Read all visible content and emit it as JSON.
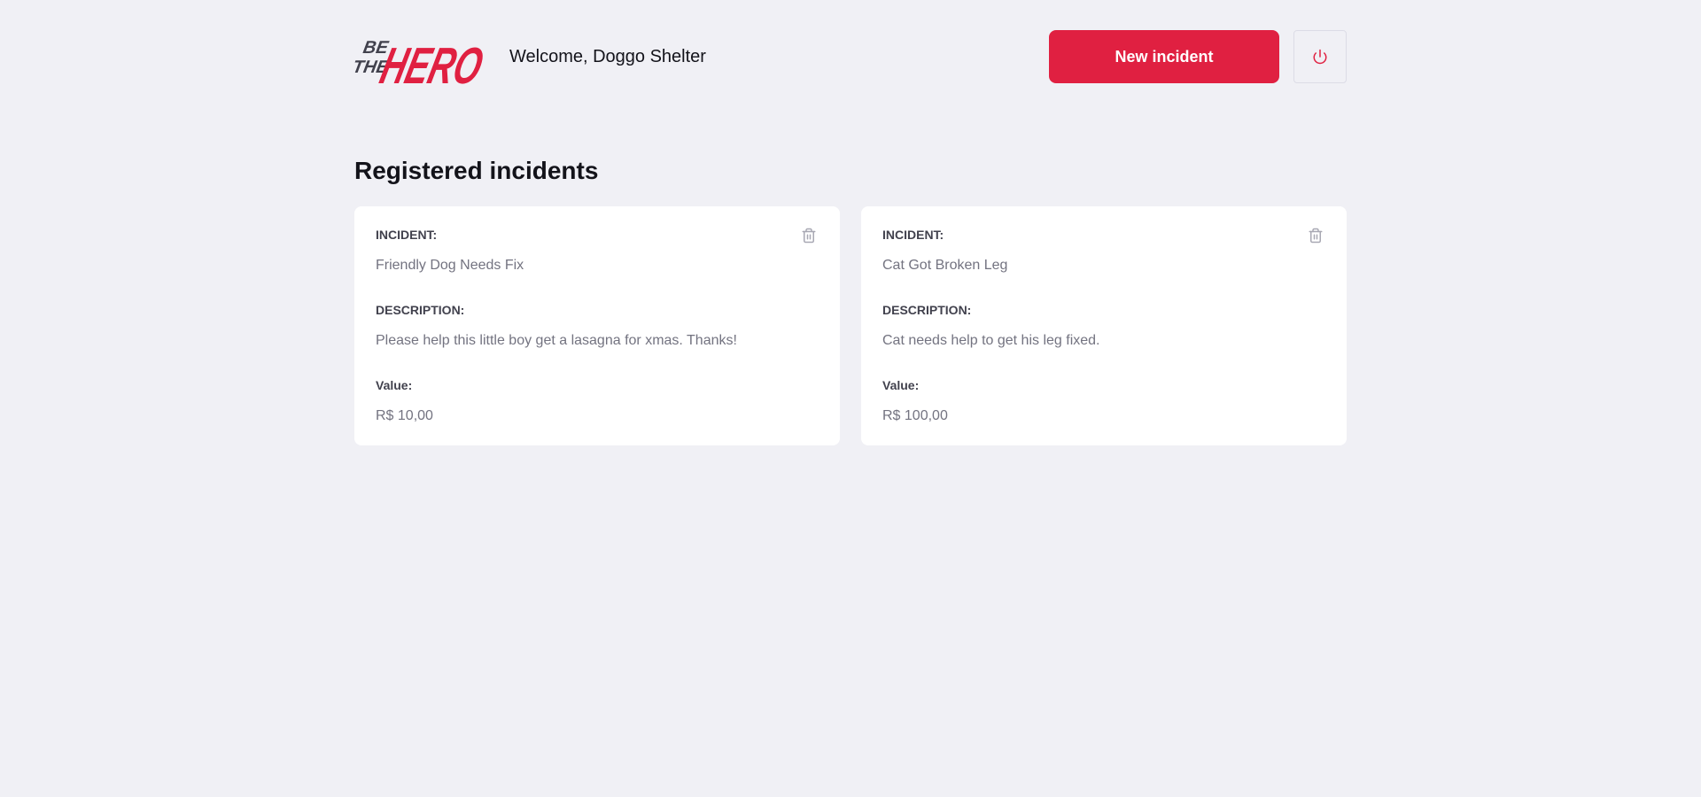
{
  "header": {
    "logo_text": "BE THE HERO",
    "welcome": "Welcome, Doggo Shelter",
    "new_incident_label": "New incident"
  },
  "page_title": "Registered incidents",
  "labels": {
    "incident": "INCIDENT:",
    "description": "DESCRIPTION:",
    "value": "Value:"
  },
  "incidents": [
    {
      "title": "Friendly Dog Needs Fix",
      "description": "Please help this little boy get a lasagna for xmas. Thanks!",
      "value": "R$ 10,00"
    },
    {
      "title": "Cat Got Broken Leg",
      "description": "Cat needs help to get his leg fixed.",
      "value": "R$ 100,00"
    }
  ],
  "icons": {
    "power": "power-icon",
    "trash": "trash-icon"
  },
  "colors": {
    "brand": "#e02041",
    "background": "#f0f0f5",
    "card": "#ffffff",
    "logo_dark": "#41414d"
  }
}
